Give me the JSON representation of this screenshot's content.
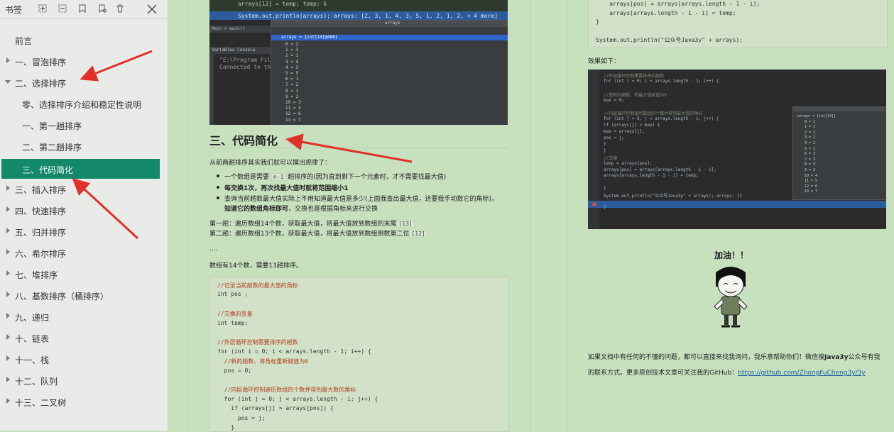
{
  "sidebar": {
    "title": "书签",
    "tools": [
      "expand-all-icon",
      "collapse-all-icon",
      "bookmark-add-icon",
      "bookmark-find-icon",
      "delete-icon",
      "close-icon"
    ],
    "items": [
      {
        "label": "前言",
        "arrow": "none",
        "indent": 0
      },
      {
        "label": "一、冒泡排序",
        "arrow": "right",
        "indent": 0
      },
      {
        "label": "二、选择排序",
        "arrow": "down",
        "indent": 0
      },
      {
        "label": "零、选择排序介绍和稳定性说明",
        "arrow": "none",
        "indent": 1
      },
      {
        "label": "一、第一趟排序",
        "arrow": "none",
        "indent": 1
      },
      {
        "label": "二、第二趟排序",
        "arrow": "none",
        "indent": 1
      },
      {
        "label": "三、代码简化",
        "arrow": "none",
        "indent": 1,
        "active": true
      },
      {
        "label": "三、插入排序",
        "arrow": "right",
        "indent": 0
      },
      {
        "label": "四、快速排序",
        "arrow": "right",
        "indent": 0
      },
      {
        "label": "五、归并排序",
        "arrow": "right",
        "indent": 0
      },
      {
        "label": "六、希尔排序",
        "arrow": "right",
        "indent": 0
      },
      {
        "label": "七、堆排序",
        "arrow": "right",
        "indent": 0
      },
      {
        "label": "八、基数排序（桶排序）",
        "arrow": "right",
        "indent": 0
      },
      {
        "label": "九、递归",
        "arrow": "right",
        "indent": 0
      },
      {
        "label": "十、链表",
        "arrow": "right",
        "indent": 0
      },
      {
        "label": "十一、栈",
        "arrow": "right",
        "indent": 0
      },
      {
        "label": "十二、队列",
        "arrow": "right",
        "indent": 0
      },
      {
        "label": "十三、二叉树",
        "arrow": "right",
        "indent": 0
      }
    ]
  },
  "page1": {
    "ide_top": {
      "line1": "arrays[12] = temp;  temp: 6",
      "line2": "System.out.println(arrays);  arrays: [2, 3, 1, 4, 3, 5, 1, 2, 1, 2, + 4 more]",
      "breadcrumb": "Main  >  main()",
      "popup_title": "arrays",
      "popup_header": "arrays = {int[14]@486}",
      "popup_items": [
        "0 = 2",
        "1 = 3",
        "2 = 1",
        "3 = 4",
        "4 = 3",
        "5 = 5",
        "6 = 1",
        "7 = 2",
        "8 = 1",
        "9 = 2",
        "10 = 3",
        "11 = 3",
        "12 = 6",
        "13 = 7"
      ],
      "tabs": "Variables  Console",
      "console1": "\"E:\\Program Fil",
      "console2": "Connected to th"
    },
    "heading": "三、代码简化",
    "intro": "从前两趟排序其实我们就可以摸出规律了：",
    "bullets": [
      {
        "pre": "一个数组是需要 ",
        "code": "n-1",
        "post": " 趟排序的(因为直到剩下一个元素时，才不需要找最大值)"
      },
      {
        "pre": "每交换1次，再次找最大值时就将范围缩小1",
        "code": "",
        "post": ""
      },
      {
        "pre": "查询当前趟数最大值实际上不用知道最大值是多少(上面我查出最大值，还要我手动数它的角标)，",
        "code": "",
        "post": ""
      },
      {
        "pre": "知道它的数组角标即可",
        "code": "",
        "post": "，交换也是根据角标来进行交换"
      }
    ],
    "lines": [
      {
        "pre": "第一趟：遍历数组14个数，获取最大值，将最大值放到数组的末尾",
        "code": "[13]"
      },
      {
        "pre": "第二趟：遍历数组13个数，获取最大值，将最大值放到数组倒数第二位",
        "code": "[12]"
      }
    ],
    "ellipsis": "....",
    "summary": "数组有14个数，需要13趟排序。",
    "code": [
      {
        "t": "//记录当前趟数的最大值的角标",
        "c": "cm"
      },
      {
        "t": "int pos ;",
        "c": ""
      },
      {
        "t": "",
        "c": ""
      },
      {
        "t": "//交换的变量",
        "c": "cm"
      },
      {
        "t": "int temp;",
        "c": ""
      },
      {
        "t": "",
        "c": ""
      },
      {
        "t": "//外层循环控制需要排序的趟数",
        "c": "cm"
      },
      {
        "t": "for (int i = 0; i < arrays.length - 1; i++) {",
        "c": ""
      },
      {
        "t": "  //新的趟数、将角标重新赋值为0",
        "c": "cm"
      },
      {
        "t": "  pos = 0;",
        "c": ""
      },
      {
        "t": "",
        "c": ""
      },
      {
        "t": "  //内层循环控制遍历数组的个数并得到最大数的角标",
        "c": "cm"
      },
      {
        "t": "  for (int j = 0; j < arrays.length - i; j++) {",
        "c": ""
      },
      {
        "t": "    if (arrays[j] > arrays[pos]) {",
        "c": ""
      },
      {
        "t": "      pos = j;",
        "c": ""
      },
      {
        "t": "    }",
        "c": ""
      }
    ]
  },
  "page2": {
    "code_top": [
      "    arrays[pos] = arrays[arrays.length - 1 - i];",
      "    arrays[arrays.length - 1 - i] = temp;",
      "}",
      "",
      "System.out.println(\"公众号Java3y\" + arrays);"
    ],
    "effect": "效果如下：",
    "ide": [
      {
        "t": "      //外层循环控制需要排序的趟数",
        "c": "#7f8a79"
      },
      {
        "t": "      for (int i = 0; i < arrays.length - 1; i++) {",
        "c": "#a9b7c6"
      },
      {
        "t": "",
        "c": "#a9b7c6"
      },
      {
        "t": "          //重新的趟数、将最大值赋值为0",
        "c": "#7f8a79"
      },
      {
        "t": "          max = 0;",
        "c": "#a9b7c6"
      },
      {
        "t": "",
        "c": "#a9b7c6"
      },
      {
        "t": "          //内层循环控制遍历数组的个数并得到最大值的角标",
        "c": "#7f8a79"
      },
      {
        "t": "          for (int j = 0; j < arrays.length - i; j++) {",
        "c": "#a9b7c6"
      },
      {
        "t": "              if (arrays[j] > max) {",
        "c": "#a9b7c6"
      },
      {
        "t": "                  max = arrays[j];",
        "c": "#a9b7c6"
      },
      {
        "t": "                  pos = j;",
        "c": "#a9b7c6"
      },
      {
        "t": "              }",
        "c": "#a9b7c6"
      },
      {
        "t": "          }",
        "c": "#a9b7c6"
      },
      {
        "t": "          //交换",
        "c": "#7f8a79"
      },
      {
        "t": "          temp = arrays[pos];",
        "c": "#a9b7c6"
      },
      {
        "t": "          arrays[pos] = arrays[arrays.length - 1 - i];",
        "c": "#a9b7c6"
      },
      {
        "t": "          arrays[arrays.length - 1 - i] = temp;",
        "c": "#a9b7c6"
      },
      {
        "t": "",
        "c": "#a9b7c6"
      },
      {
        "t": "      }",
        "c": "#a9b7c6"
      },
      {
        "t": "      System.out.println(\"公众号Java3y\" + arrays);  arrays: [1",
        "c": "#a9b7c6"
      },
      {
        "t": "",
        "c": "#a9b7c6"
      },
      {
        "t": "  }",
        "c": "#a9b7c6"
      }
    ],
    "ide_popup": [
      "arrays = {int[14]}",
      "0 = 1",
      "1 = 1",
      "2 = 1",
      "3 = 2",
      "4 = 2",
      "5 = 2",
      "6 = 3",
      "7 = 3",
      "8 = 3",
      "9 = 3",
      "10 = 4",
      "11 = 5",
      "12 = 6",
      "13 = 7"
    ],
    "meme_caption": "加油！！",
    "closing1_pre": "如果文档中有任何的不懂的问题，都可以直接来找我询问，我乐意帮助你们！微信搜",
    "closing1_bold": "Java3y",
    "closing1_post": "公众号有我",
    "closing2": "的联系方式。更多原创技术文章可关注我的GitHub：",
    "link": "https://github.com/ZhongFuCheng3y/3y"
  }
}
